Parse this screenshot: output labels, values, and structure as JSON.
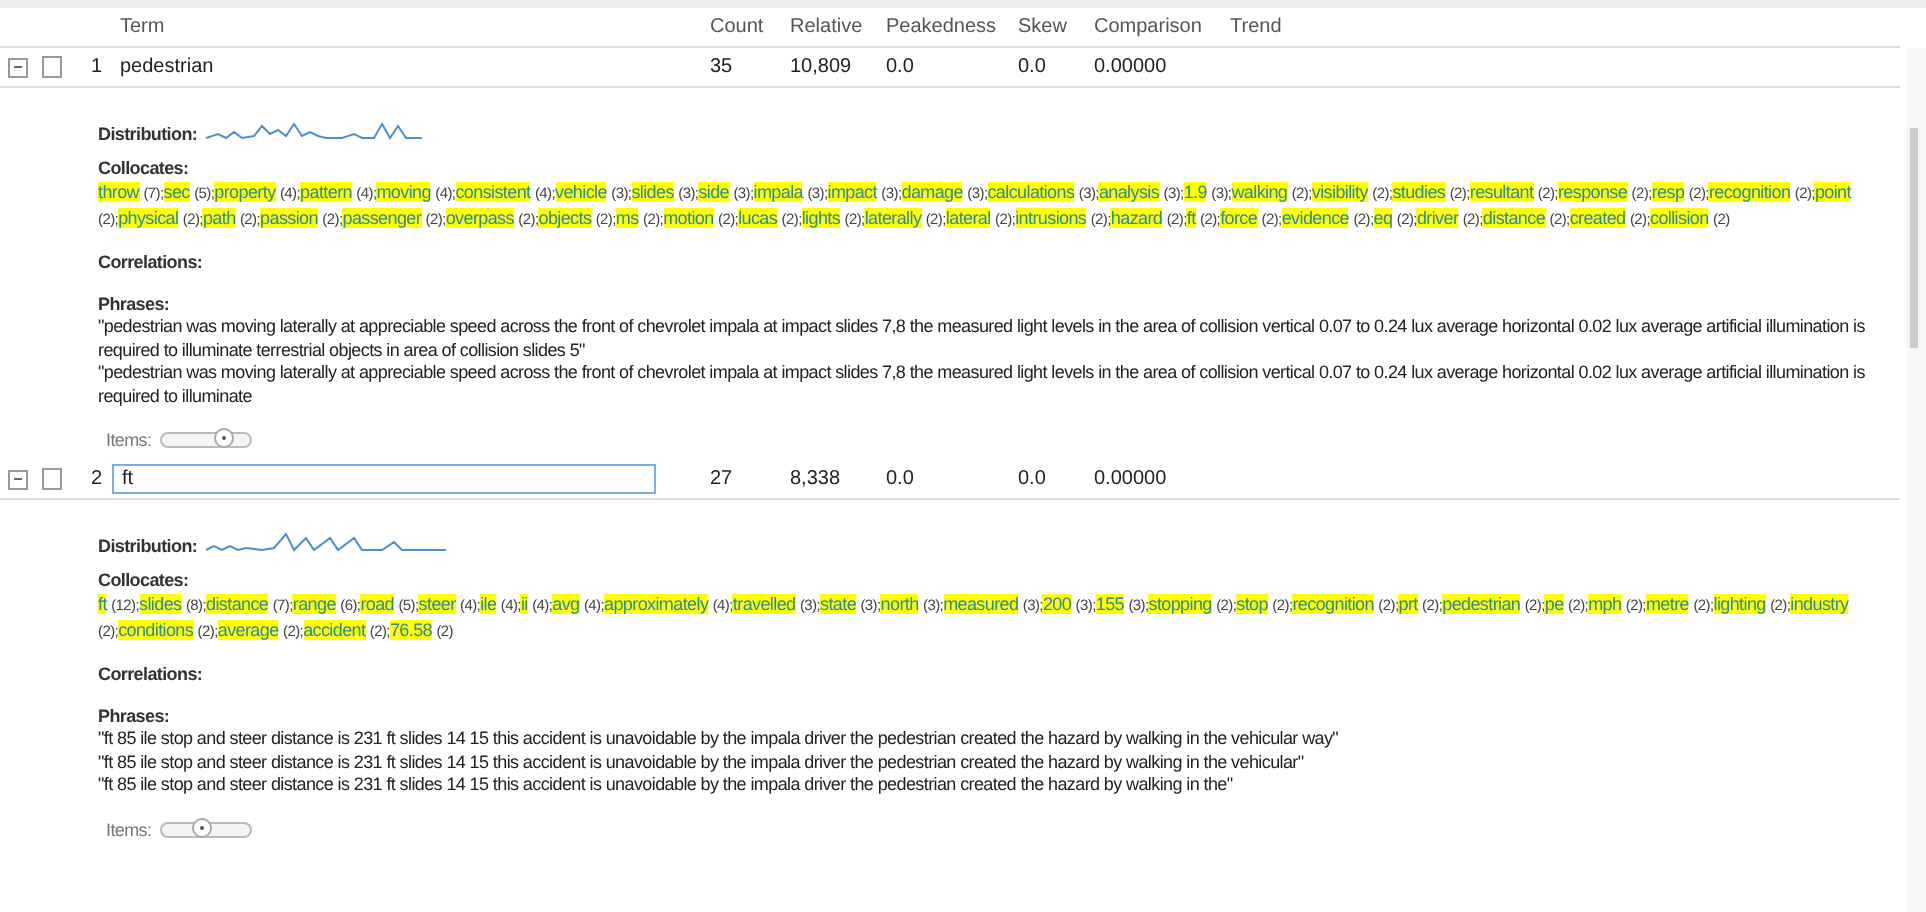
{
  "table": {
    "columns": [
      "Term",
      "Count",
      "Relative",
      "Peakedness",
      "Skew",
      "Comparison",
      "Trend"
    ],
    "rows": [
      {
        "expanded": true,
        "checked": false,
        "index": "1",
        "term": "pedestrian",
        "editing": false,
        "count": "35",
        "relative": "10,809",
        "peakedness": "0.0",
        "skew": "0.0",
        "comparison": "0.00000",
        "distribution_label": "Distribution:",
        "collocates_label": "Collocates:",
        "collocates": [
          {
            "term": "throw",
            "count": "(7);"
          },
          {
            "term": "sec",
            "count": "(5);"
          },
          {
            "term": "property",
            "count": "(4);"
          },
          {
            "term": "pattern",
            "count": "(4);"
          },
          {
            "term": "moving",
            "count": "(4);"
          },
          {
            "term": "consistent",
            "count": "(4);"
          },
          {
            "term": "vehicle",
            "count": "(3);"
          },
          {
            "term": "slides",
            "count": "(3);"
          },
          {
            "term": "side",
            "count": "(3);"
          },
          {
            "term": "impala",
            "count": "(3);"
          },
          {
            "term": "impact",
            "count": "(3);"
          },
          {
            "term": "damage",
            "count": "(3);"
          },
          {
            "term": "calculations",
            "count": "(3);"
          },
          {
            "term": "analysis",
            "count": "(3);"
          },
          {
            "term": "1.9",
            "count": "(3);"
          },
          {
            "term": "walking",
            "count": "(2);"
          },
          {
            "term": "visibility",
            "count": "(2);"
          },
          {
            "term": "studies",
            "count": "(2);"
          },
          {
            "term": "resultant",
            "count": "(2);"
          },
          {
            "term": "response",
            "count": "(2);"
          },
          {
            "term": "resp",
            "count": "(2);"
          },
          {
            "term": "recognition",
            "count": "(2);"
          },
          {
            "term": "point",
            "count": "(2);"
          },
          {
            "term": "physical",
            "count": "(2);"
          },
          {
            "term": "path",
            "count": "(2);"
          },
          {
            "term": "passion",
            "count": "(2);"
          },
          {
            "term": "passenger",
            "count": "(2);"
          },
          {
            "term": "overpass",
            "count": "(2);"
          },
          {
            "term": "objects",
            "count": "(2);"
          },
          {
            "term": "ms",
            "count": "(2);"
          },
          {
            "term": "motion",
            "count": "(2);"
          },
          {
            "term": "lucas",
            "count": "(2);"
          },
          {
            "term": "lights",
            "count": "(2);"
          },
          {
            "term": "laterally",
            "count": "(2);"
          },
          {
            "term": "lateral",
            "count": "(2);"
          },
          {
            "term": "intrusions",
            "count": "(2);"
          },
          {
            "term": "hazard",
            "count": "(2);"
          },
          {
            "term": "ft",
            "count": "(2);"
          },
          {
            "term": "force",
            "count": "(2);"
          },
          {
            "term": "evidence",
            "count": "(2);"
          },
          {
            "term": "eq",
            "count": "(2);"
          },
          {
            "term": "driver",
            "count": "(2);"
          },
          {
            "term": "distance",
            "count": "(2);"
          },
          {
            "term": "created",
            "count": "(2);"
          },
          {
            "term": "collision",
            "count": "(2)"
          }
        ],
        "correlations_label": "Correlations:",
        "phrases_label": "Phrases:",
        "phrases": [
          "\"pedestrian was moving laterally at appreciable speed across the front of chevrolet impala at impact slides 7,8 the measured light levels in the area of collision vertical 0.07 to 0.24 lux average horizontal 0.02 lux average artificial illumination is required to illuminate terrestrial objects in area of collision slides 5\"",
          "\"pedestrian was moving laterally at appreciable speed across the front of chevrolet impala at impact slides 7,8 the measured light levels in the area of collision vertical 0.07 to 0.24 lux average horizontal 0.02 lux average artificial illumination is required to illuminate"
        ],
        "items_label": "Items:",
        "items_slider": {
          "level": 0.7
        }
      },
      {
        "expanded": true,
        "checked": false,
        "index": "2",
        "term": "ft",
        "editing": true,
        "count": "27",
        "relative": "8,338",
        "peakedness": "0.0",
        "skew": "0.0",
        "comparison": "0.00000",
        "distribution_label": "Distribution:",
        "collocates_label": "Collocates:",
        "collocates": [
          {
            "term": "ft",
            "count": "(12);"
          },
          {
            "term": "slides",
            "count": "(8);"
          },
          {
            "term": "distance",
            "count": "(7);"
          },
          {
            "term": "range",
            "count": "(6);"
          },
          {
            "term": "road",
            "count": "(5);"
          },
          {
            "term": "steer",
            "count": "(4);"
          },
          {
            "term": "ile",
            "count": "(4);"
          },
          {
            "term": "ii",
            "count": "(4);"
          },
          {
            "term": "avg",
            "count": "(4);"
          },
          {
            "term": "approximately",
            "count": "(4);"
          },
          {
            "term": "travelled",
            "count": "(3);"
          },
          {
            "term": "state",
            "count": "(3);"
          },
          {
            "term": "north",
            "count": "(3);"
          },
          {
            "term": "measured",
            "count": "(3);"
          },
          {
            "term": "200",
            "count": "(3);"
          },
          {
            "term": "155",
            "count": "(3);"
          },
          {
            "term": "stopping",
            "count": "(2);"
          },
          {
            "term": "stop",
            "count": "(2);"
          },
          {
            "term": "recognition",
            "count": "(2);"
          },
          {
            "term": "prt",
            "count": "(2);"
          },
          {
            "term": "pedestrian",
            "count": "(2);"
          },
          {
            "term": "pe",
            "count": "(2);"
          },
          {
            "term": "mph",
            "count": "(2);"
          },
          {
            "term": "metre",
            "count": "(2);"
          },
          {
            "term": "lighting",
            "count": "(2);"
          },
          {
            "term": "industry",
            "count": "(2);"
          },
          {
            "term": "conditions",
            "count": "(2);"
          },
          {
            "term": "average",
            "count": "(2);"
          },
          {
            "term": "accident",
            "count": "(2);"
          },
          {
            "term": "76.58",
            "count": "(2)"
          }
        ],
        "correlations_label": "Correlations:",
        "phrases_label": "Phrases:",
        "phrases": [
          "\"ft 85 ile stop and steer distance is 231 ft slides 14 15 this accident is unavoidable by the impala driver the pedestrian created the hazard by walking in the vehicular way\"",
          "\"ft 85 ile stop and steer distance is 231 ft slides 14 15 this accident is unavoidable by the impala driver the pedestrian created the hazard by walking in the vehicular\"",
          "\"ft 85 ile stop and steer distance is 231 ft slides 14 15 this accident is unavoidable by the impala driver the pedestrian created the hazard by walking in the\""
        ],
        "items_label": "Items:",
        "items_slider": {
          "level": 0.45
        }
      }
    ]
  }
}
